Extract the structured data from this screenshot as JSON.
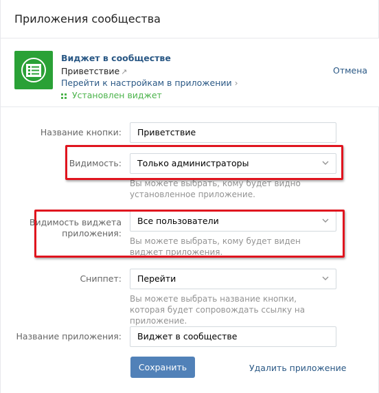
{
  "header": {
    "title": "Приложения сообщества"
  },
  "app": {
    "name": "Виджет в сообществе",
    "subtitle": "Приветствие",
    "settings_link": "Перейти к настройкам в приложении",
    "status": "Установлен виджет",
    "cancel_label": "Отмена",
    "icon": "widget-list-icon",
    "icon_color": "#2aa136"
  },
  "form": {
    "button_name": {
      "label": "Название кнопки:",
      "value": "Приветствие"
    },
    "visibility": {
      "label": "Видимость:",
      "value": "Только администраторы",
      "hint": "Вы можете выбрать, кому будет видно установленное приложение."
    },
    "widget_visibility": {
      "label_line1": "Видимость виджета",
      "label_line2": "приложения:",
      "value": "Все пользователи",
      "hint": "Вы можете выбрать, кому будет виден виджет приложения."
    },
    "snippet": {
      "label": "Сниппет:",
      "value": "Перейти",
      "hint": "Вы можете выбрать название кнопки, которая будет сопровождать ссылку на приложение."
    },
    "app_name": {
      "label": "Название приложения:",
      "value": "Виджет в сообществе"
    },
    "save_label": "Сохранить",
    "delete_label": "Удалить приложение"
  },
  "colors": {
    "accent": "#5181b8",
    "link": "#2a5885",
    "highlight": "#e0141e",
    "status": "#4bb34b"
  }
}
